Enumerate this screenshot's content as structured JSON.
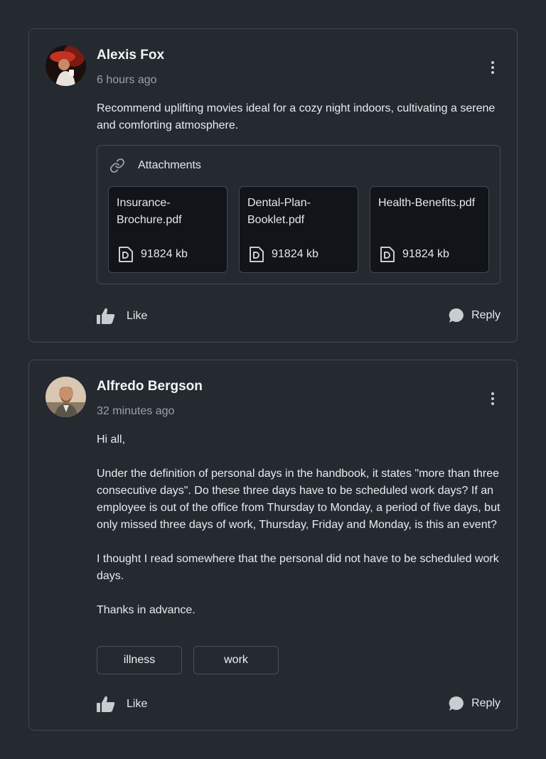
{
  "comments": [
    {
      "author": "Alexis Fox",
      "time": "6 hours ago",
      "paragraphs": [
        "Recommend uplifting movies ideal for a cozy night indoors, cultivating a serene and comforting atmosphere."
      ],
      "attachments": {
        "label": "Attachments",
        "files": [
          {
            "name": "Insurance-Brochure.pdf",
            "size": "91824 kb"
          },
          {
            "name": "Dental-Plan-Booklet.pdf",
            "size": "91824 kb"
          },
          {
            "name": "Health-Benefits.pdf",
            "size": "91824 kb"
          }
        ]
      },
      "like_label": "Like",
      "reply_label": "Reply",
      "avatar_icon": "avatar-photo-icon"
    },
    {
      "author": "Alfredo Bergson",
      "time": "32 minutes ago",
      "paragraphs": [
        "Hi all,",
        "Under the definition of personal days in the handbook, it states \"more than three consecutive days\". Do these three days have to be scheduled work days? If an employee is out of the office from Thursday to Monday, a period of five days, but only missed three days of work, Thursday, Friday and Monday, is this an event?",
        "I thought I read somewhere that the personal did not have to be scheduled work days.",
        "Thanks in advance."
      ],
      "tags": [
        "illness",
        "work"
      ],
      "like_label": "Like",
      "reply_label": "Reply",
      "avatar_icon": "avatar-photo-icon"
    }
  ],
  "icons": {
    "menu": "kebab-menu-icon",
    "attachment": "link-icon",
    "file": "document-icon",
    "like": "thumbs-up-icon",
    "reply": "speech-bubble-icon"
  },
  "colors": {
    "background": "#252a31",
    "border": "#434950",
    "file_card": "#111418",
    "muted_text": "#9aa1aa"
  }
}
